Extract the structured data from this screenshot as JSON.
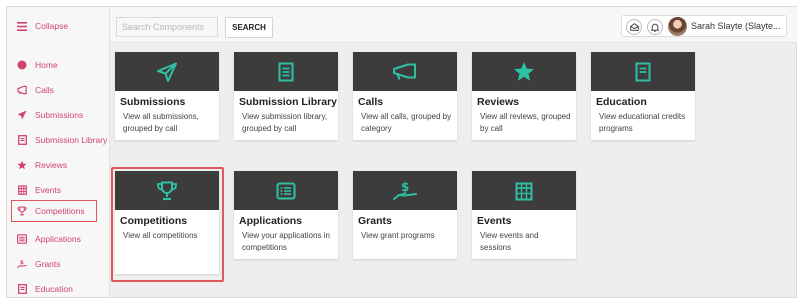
{
  "header": {
    "search_placeholder": "Search Components",
    "search_button": "SEARCH",
    "user_name": "Sarah Slayte (Slayte..."
  },
  "sidebar": {
    "collapse_label": "Collapse",
    "items": [
      {
        "label": "Home",
        "icon": "home-dot-icon"
      },
      {
        "label": "Calls",
        "icon": "megaphone-icon"
      },
      {
        "label": "Submissions",
        "icon": "paper-plane-icon"
      },
      {
        "label": "Submission Library",
        "icon": "library-icon"
      },
      {
        "label": "Reviews",
        "icon": "star-icon"
      },
      {
        "label": "Events",
        "icon": "calendar-icon"
      },
      {
        "label": "Competitions",
        "icon": "trophy-icon",
        "active": true
      },
      {
        "label": "Applications",
        "icon": "application-list-icon"
      },
      {
        "label": "Grants",
        "icon": "grant-hand-icon"
      },
      {
        "label": "Education",
        "icon": "book-icon"
      }
    ]
  },
  "cards": [
    {
      "title": "Submissions",
      "desc": "View all submissions, grouped by call",
      "icon": "paper-plane-icon"
    },
    {
      "title": "Submission Library",
      "desc": "View submission library, grouped by call",
      "icon": "library-icon"
    },
    {
      "title": "Calls",
      "desc": "View all calls, grouped by category",
      "icon": "megaphone-icon"
    },
    {
      "title": "Reviews",
      "desc": "View all reviews, grouped by call",
      "icon": "star-icon"
    },
    {
      "title": "Education",
      "desc": "View educational credits programs",
      "icon": "book-icon"
    },
    {
      "title": "Competitions",
      "desc": "View all competitions",
      "icon": "trophy-icon"
    },
    {
      "title": "Applications",
      "desc": "View your applications in competitions",
      "icon": "application-list-icon"
    },
    {
      "title": "Grants",
      "desc": "View grant programs",
      "icon": "grant-hand-icon"
    },
    {
      "title": "Events",
      "desc": "View events and sessions",
      "icon": "calendar-icon"
    }
  ],
  "colors": {
    "accent_pink": "#d0446c",
    "card_icon_teal": "#2fc0a3",
    "card_banner": "#3c3c3c",
    "highlight_red": "#e0585a"
  }
}
